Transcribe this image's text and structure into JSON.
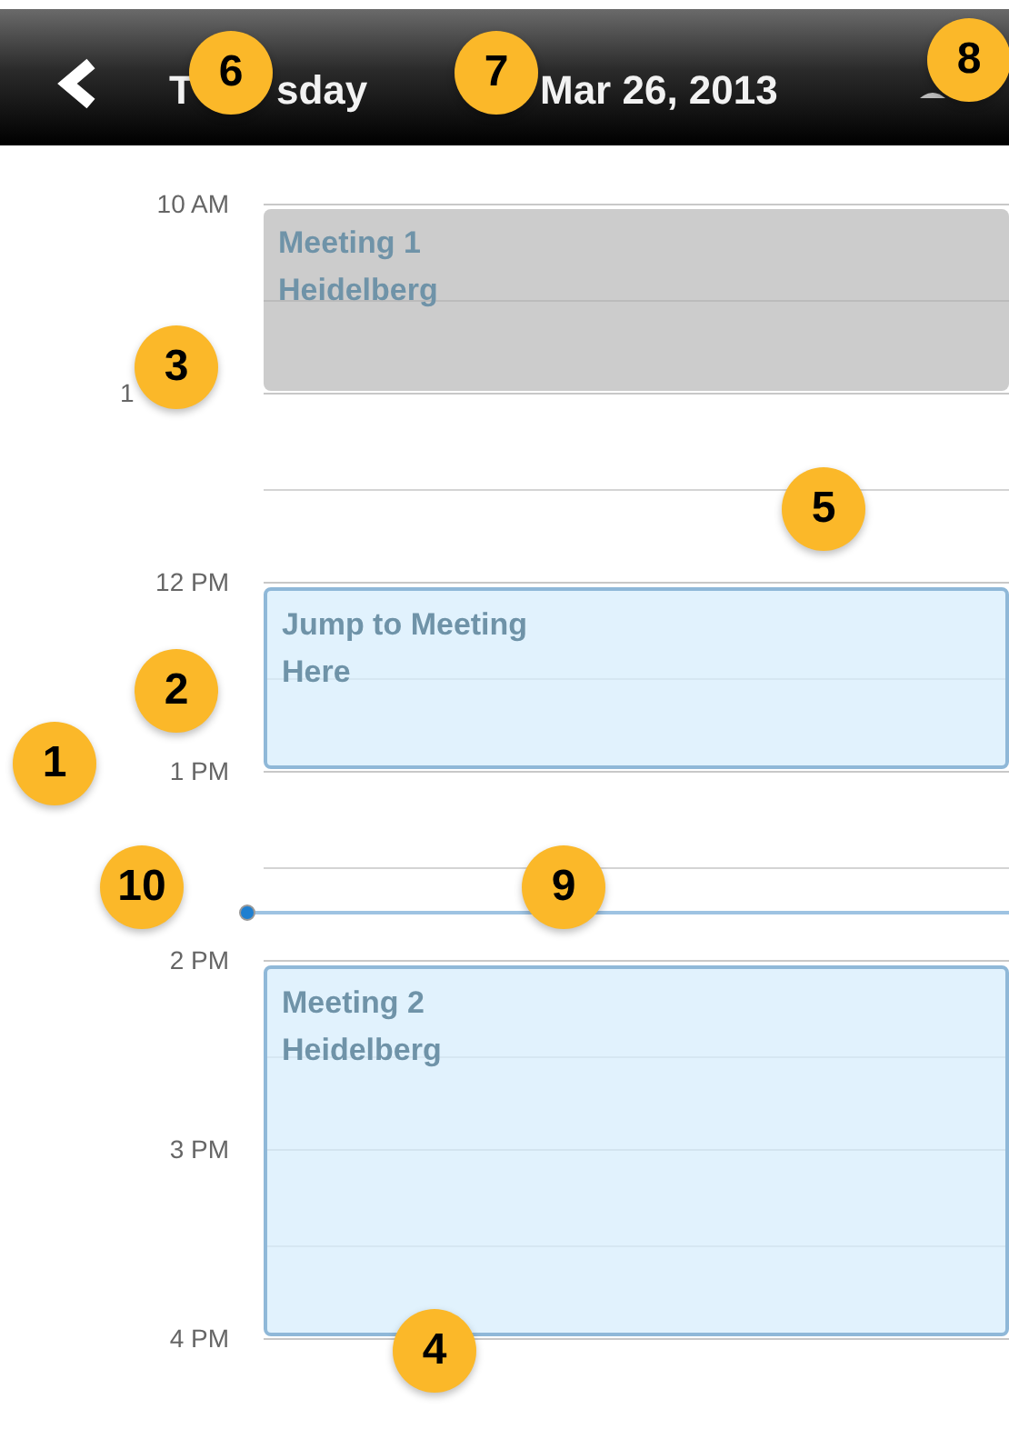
{
  "header": {
    "day_parts": [
      "T",
      "sday"
    ],
    "date": "Mar 26, 2013"
  },
  "hours": [
    {
      "label": "10 AM",
      "kind": "plain"
    },
    {
      "label": "1",
      "kind": "covered"
    },
    {
      "label": "12 PM",
      "kind": "plain"
    },
    {
      "label": "1 PM",
      "kind": "plain"
    },
    {
      "label": "2 PM",
      "kind": "plain"
    },
    {
      "label": "3 PM",
      "kind": "plain"
    },
    {
      "label": "4 PM",
      "kind": "plain"
    }
  ],
  "events": [
    {
      "kind": "past",
      "title": "Meeting 1",
      "location": "Heidelberg"
    },
    {
      "kind": "upcoming",
      "title": "Jump to Meeting",
      "location": "Here"
    },
    {
      "kind": "upcoming",
      "title": "Meeting 2",
      "location": "Heidelberg"
    }
  ],
  "callouts": [
    {
      "label": "1"
    },
    {
      "label": "2"
    },
    {
      "label": "3"
    },
    {
      "label": "4"
    },
    {
      "label": "5"
    },
    {
      "label": "6"
    },
    {
      "label": "7"
    },
    {
      "label": "8"
    },
    {
      "label": "9"
    },
    {
      "label": "10"
    }
  ]
}
